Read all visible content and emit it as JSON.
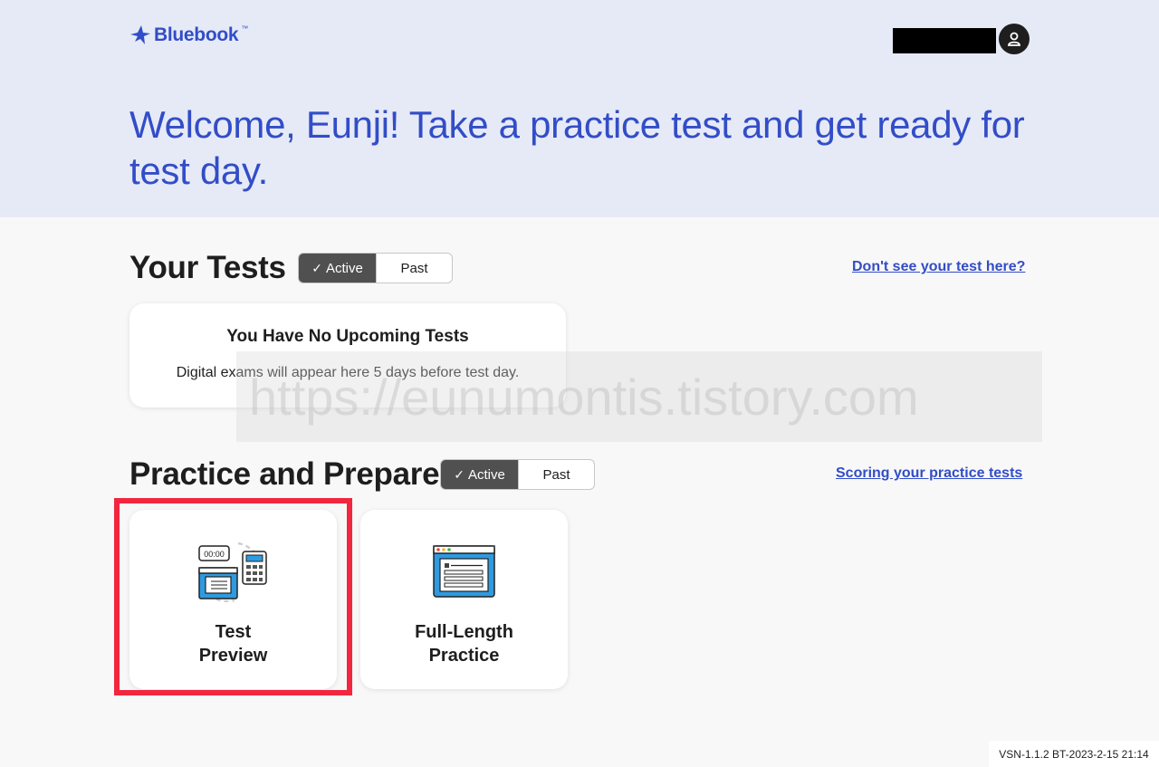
{
  "header": {
    "logo_text": "Bluebook",
    "logo_tm": "™",
    "greeting": "Welcome, Eunji! Take a practice test and get ready for test day."
  },
  "your_tests": {
    "title": "Your Tests",
    "toggle_active": "Active",
    "toggle_past": "Past",
    "help_link": "Don't see your test here?",
    "empty_title": "You Have No Upcoming Tests",
    "empty_desc": "Digital exams will appear here 5 days before test day."
  },
  "practice": {
    "title": "Practice and Prepare",
    "toggle_active": "Active",
    "toggle_past": "Past",
    "help_link": "Scoring your practice tests",
    "tiles": [
      {
        "line1": "Test",
        "line2": "Preview",
        "icon": "test-preview-icon",
        "timer": "00:00"
      },
      {
        "line1": "Full-Length",
        "line2": "Practice",
        "icon": "full-length-practice-icon"
      }
    ]
  },
  "watermark": "https://eunumontis.tistory.com",
  "version": "VSN-1.1.2 BT-2023-2-15 21:14",
  "colors": {
    "brand_blue": "#324dc7",
    "hero_bg": "#e6eaf7",
    "toggle_active_bg": "#505050",
    "highlight_red": "#f2263f"
  }
}
